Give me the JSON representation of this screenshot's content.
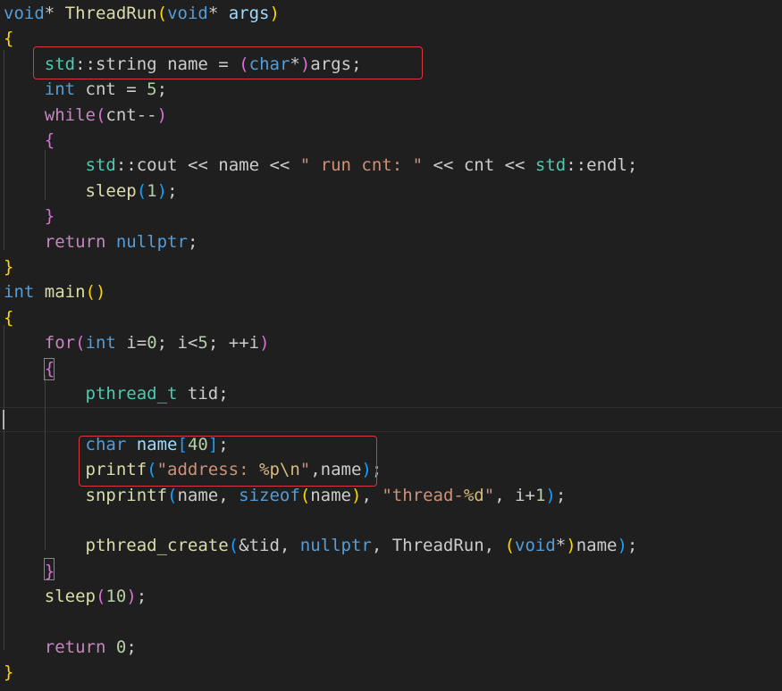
{
  "editor": {
    "lines": [
      [
        {
          "t": "void",
          "c": "kw"
        },
        {
          "t": "* ",
          "c": "plain"
        },
        {
          "t": "ThreadRun",
          "c": "fn"
        },
        {
          "t": "(",
          "c": "b1"
        },
        {
          "t": "void",
          "c": "kw"
        },
        {
          "t": "* ",
          "c": "plain"
        },
        {
          "t": "args",
          "c": "var"
        },
        {
          "t": ")",
          "c": "b1"
        }
      ],
      [
        {
          "t": "{",
          "c": "b1"
        }
      ],
      [
        {
          "t": "    ",
          "c": "plain"
        },
        {
          "t": "std",
          "c": "type"
        },
        {
          "t": "::",
          "c": "plain"
        },
        {
          "t": "string",
          "c": "plain"
        },
        {
          "t": " ",
          "c": "plain"
        },
        {
          "t": "name",
          "c": "plain"
        },
        {
          "t": " = ",
          "c": "plain"
        },
        {
          "t": "(",
          "c": "b2"
        },
        {
          "t": "char",
          "c": "kw"
        },
        {
          "t": "*",
          "c": "plain"
        },
        {
          "t": ")",
          "c": "b2"
        },
        {
          "t": "args",
          "c": "plain"
        },
        {
          "t": ";",
          "c": "plain"
        }
      ],
      [
        {
          "t": "    ",
          "c": "plain"
        },
        {
          "t": "int",
          "c": "kw"
        },
        {
          "t": " cnt = ",
          "c": "plain"
        },
        {
          "t": "5",
          "c": "num"
        },
        {
          "t": ";",
          "c": "plain"
        }
      ],
      [
        {
          "t": "    ",
          "c": "plain"
        },
        {
          "t": "while",
          "c": "ctrl"
        },
        {
          "t": "(",
          "c": "b2"
        },
        {
          "t": "cnt--",
          "c": "plain"
        },
        {
          "t": ")",
          "c": "b2"
        }
      ],
      [
        {
          "t": "    ",
          "c": "plain"
        },
        {
          "t": "{",
          "c": "b2"
        }
      ],
      [
        {
          "t": "        ",
          "c": "plain"
        },
        {
          "t": "std",
          "c": "type"
        },
        {
          "t": "::",
          "c": "plain"
        },
        {
          "t": "cout",
          "c": "plain"
        },
        {
          "t": " << name << ",
          "c": "plain"
        },
        {
          "t": "\" run cnt: \"",
          "c": "str"
        },
        {
          "t": " << cnt << ",
          "c": "plain"
        },
        {
          "t": "std",
          "c": "type"
        },
        {
          "t": "::",
          "c": "plain"
        },
        {
          "t": "endl",
          "c": "plain"
        },
        {
          "t": ";",
          "c": "plain"
        }
      ],
      [
        {
          "t": "        ",
          "c": "plain"
        },
        {
          "t": "sleep",
          "c": "fn"
        },
        {
          "t": "(",
          "c": "b3"
        },
        {
          "t": "1",
          "c": "num"
        },
        {
          "t": ")",
          "c": "b3"
        },
        {
          "t": ";",
          "c": "plain"
        }
      ],
      [
        {
          "t": "    ",
          "c": "plain"
        },
        {
          "t": "}",
          "c": "b2"
        }
      ],
      [
        {
          "t": "    ",
          "c": "plain"
        },
        {
          "t": "return",
          "c": "ctrl"
        },
        {
          "t": " ",
          "c": "plain"
        },
        {
          "t": "nullptr",
          "c": "kw"
        },
        {
          "t": ";",
          "c": "plain"
        }
      ],
      [
        {
          "t": "}",
          "c": "b1"
        }
      ],
      [
        {
          "t": "int",
          "c": "kw"
        },
        {
          "t": " ",
          "c": "plain"
        },
        {
          "t": "main",
          "c": "fn"
        },
        {
          "t": "()",
          "c": "b1"
        }
      ],
      [
        {
          "t": "{",
          "c": "b1"
        }
      ],
      [
        {
          "t": "    ",
          "c": "plain"
        },
        {
          "t": "for",
          "c": "ctrl"
        },
        {
          "t": "(",
          "c": "b2"
        },
        {
          "t": "int",
          "c": "kw"
        },
        {
          "t": " i=",
          "c": "plain"
        },
        {
          "t": "0",
          "c": "num"
        },
        {
          "t": "; i<",
          "c": "plain"
        },
        {
          "t": "5",
          "c": "num"
        },
        {
          "t": "; ++i",
          "c": "plain"
        },
        {
          "t": ")",
          "c": "b2"
        }
      ],
      [
        {
          "t": "    ",
          "c": "plain"
        },
        {
          "t": "{",
          "c": "b2"
        }
      ],
      [
        {
          "t": "        ",
          "c": "plain"
        },
        {
          "t": "pthread_t",
          "c": "type"
        },
        {
          "t": " tid;",
          "c": "plain"
        }
      ],
      [
        {
          "t": "",
          "c": "plain"
        }
      ],
      [
        {
          "t": "        ",
          "c": "plain"
        },
        {
          "t": "char",
          "c": "kw"
        },
        {
          "t": " ",
          "c": "plain"
        },
        {
          "t": "name",
          "c": "var"
        },
        {
          "t": "[",
          "c": "b3"
        },
        {
          "t": "40",
          "c": "num"
        },
        {
          "t": "]",
          "c": "b3"
        },
        {
          "t": ";",
          "c": "plain"
        }
      ],
      [
        {
          "t": "        ",
          "c": "plain"
        },
        {
          "t": "printf",
          "c": "fn"
        },
        {
          "t": "(",
          "c": "b3"
        },
        {
          "t": "\"address: ",
          "c": "str"
        },
        {
          "t": "%p\\n",
          "c": "esc"
        },
        {
          "t": "\"",
          "c": "str"
        },
        {
          "t": ",name",
          "c": "plain"
        },
        {
          "t": ")",
          "c": "b3"
        },
        {
          "t": ";",
          "c": "plain"
        }
      ],
      [
        {
          "t": "        ",
          "c": "plain"
        },
        {
          "t": "snprintf",
          "c": "fn"
        },
        {
          "t": "(",
          "c": "b3"
        },
        {
          "t": "name, ",
          "c": "plain"
        },
        {
          "t": "sizeof",
          "c": "kw"
        },
        {
          "t": "(",
          "c": "b1"
        },
        {
          "t": "name",
          "c": "plain"
        },
        {
          "t": ")",
          "c": "b1"
        },
        {
          "t": ", ",
          "c": "plain"
        },
        {
          "t": "\"thread-",
          "c": "str"
        },
        {
          "t": "%d",
          "c": "esc"
        },
        {
          "t": "\"",
          "c": "str"
        },
        {
          "t": ", i+",
          "c": "plain"
        },
        {
          "t": "1",
          "c": "num"
        },
        {
          "t": ")",
          "c": "b3"
        },
        {
          "t": ";",
          "c": "plain"
        }
      ],
      [
        {
          "t": "",
          "c": "plain"
        }
      ],
      [
        {
          "t": "        ",
          "c": "plain"
        },
        {
          "t": "pthread_create",
          "c": "fn"
        },
        {
          "t": "(",
          "c": "b3"
        },
        {
          "t": "&tid, ",
          "c": "plain"
        },
        {
          "t": "nullptr",
          "c": "kw"
        },
        {
          "t": ", ThreadRun, ",
          "c": "plain"
        },
        {
          "t": "(",
          "c": "b1"
        },
        {
          "t": "void",
          "c": "kw"
        },
        {
          "t": "*",
          "c": "plain"
        },
        {
          "t": ")",
          "c": "b1"
        },
        {
          "t": "name",
          "c": "plain"
        },
        {
          "t": ")",
          "c": "b3"
        },
        {
          "t": ";",
          "c": "plain"
        }
      ],
      [
        {
          "t": "    ",
          "c": "plain"
        },
        {
          "t": "}",
          "c": "b2"
        }
      ],
      [
        {
          "t": "    ",
          "c": "plain"
        },
        {
          "t": "sleep",
          "c": "fn"
        },
        {
          "t": "(",
          "c": "b2"
        },
        {
          "t": "10",
          "c": "num"
        },
        {
          "t": ")",
          "c": "b2"
        },
        {
          "t": ";",
          "c": "plain"
        }
      ],
      [
        {
          "t": "",
          "c": "plain"
        }
      ],
      [
        {
          "t": "    ",
          "c": "plain"
        },
        {
          "t": "return",
          "c": "ctrl"
        },
        {
          "t": " ",
          "c": "plain"
        },
        {
          "t": "0",
          "c": "num"
        },
        {
          "t": ";",
          "c": "plain"
        }
      ],
      [
        {
          "t": "}",
          "c": "b1"
        }
      ]
    ]
  },
  "colors": {
    "background": "#1f1f1f",
    "highlight_box": "#d9373f",
    "keyword": "#569cd6",
    "control": "#c586c0",
    "function": "#dcdcaa",
    "type": "#4ec9b0",
    "string": "#ce9178",
    "number": "#b5cea8"
  }
}
